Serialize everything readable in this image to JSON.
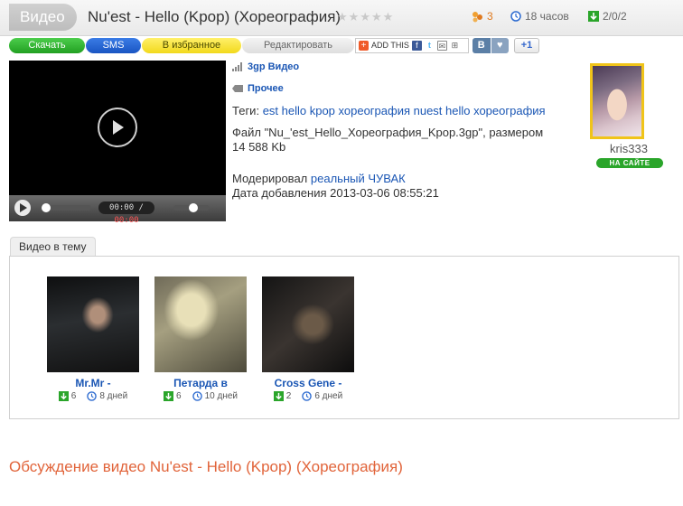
{
  "header": {
    "section": "Видео",
    "title": "Nu'est - Hello (Kpop) (Хореография)",
    "rating_stars": 5,
    "views": "3",
    "age": "18 часов",
    "downloads": "2/0/2"
  },
  "actions": {
    "download": "Скачать",
    "sms": "SMS",
    "favorite": "В избранное",
    "edit": "Редактировать",
    "addthis": "ADD THIS",
    "vk": "В",
    "plus_one": "+1"
  },
  "player": {
    "current_time": "00:00",
    "separator": "/",
    "duration": "00:00"
  },
  "categories": {
    "gp3": "3gp Видео",
    "other": "Прочее"
  },
  "info": {
    "tags_label": "Теги:",
    "tags": "est hello kpop хореография nuest hello хореография",
    "file_line": "Файл \"Nu_'est_Hello_Хореография_Kpop.3gp\", размером",
    "size": "14 588 Kb",
    "moderated_label": "Модерировал",
    "moderator": "реальный ЧУВАК",
    "date_label": "Дата добавления",
    "date": "2013-03-06 08:55:21"
  },
  "user": {
    "name": "kris333",
    "status": "НА САЙТЕ"
  },
  "related": {
    "tab": "Видео в тему",
    "items": [
      {
        "title": "Mr.Mr -",
        "downloads": "6",
        "age": "8 дней"
      },
      {
        "title": "Петарда в",
        "downloads": "6",
        "age": "10 дней"
      },
      {
        "title": "Cross Gene -",
        "downloads": "2",
        "age": "6 дней"
      }
    ]
  },
  "discussion": "Обсуждение видео Nu'est - Hello (Kpop) (Хореография)",
  "colors": {
    "link": "#1a56b4",
    "discussion": "#e1643a",
    "download_button": "#22a022",
    "sms_button": "#1a55c2",
    "favorite_button": "#f2d91c",
    "online_badge": "#2aa52a"
  }
}
